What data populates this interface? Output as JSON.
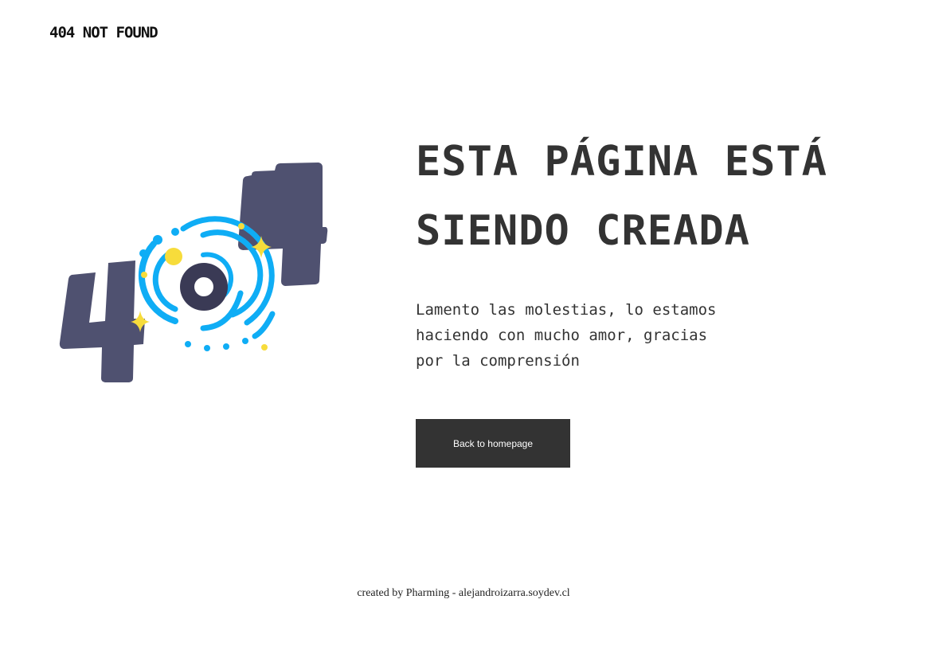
{
  "brand": {
    "label": "404 NOT FOUND"
  },
  "illustration": {
    "left_digit": "4",
    "right_digit": "4",
    "colors": {
      "digit": "#4f5170",
      "ring": "#0fadf5",
      "center": "#3a3a55",
      "sparkle": "#f7dc3b"
    }
  },
  "main": {
    "headline_line1": "ESTA PÁGINA ESTÁ",
    "headline_line2": "SIENDO CREADA",
    "message_line1": "Lamento las molestias, lo estamos",
    "message_line2": "haciendo con mucho amor, gracias",
    "message_line3": "por la comprensión",
    "button_label": "Back to homepage"
  },
  "footer": {
    "prefix": "created by ",
    "author": "Pharming",
    "separator": " - ",
    "site": "alejandroizarra.soydev.cl"
  }
}
